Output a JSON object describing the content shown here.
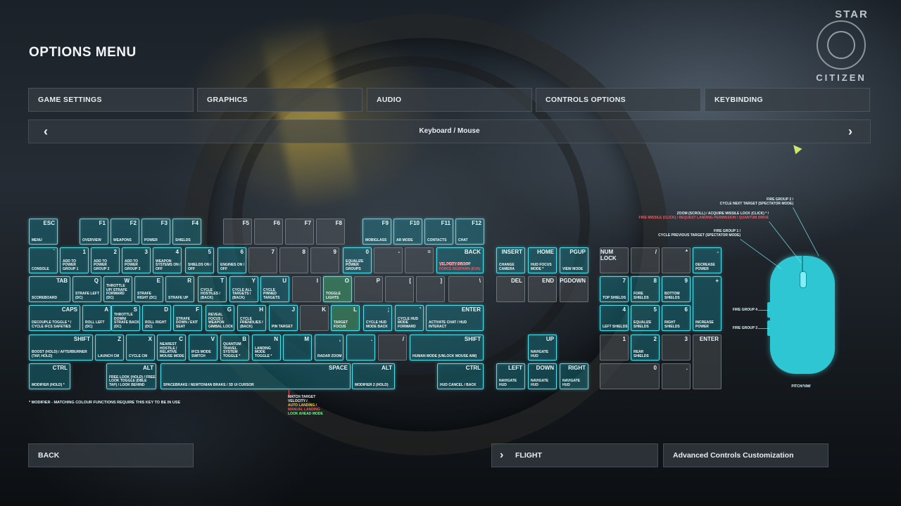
{
  "window": {
    "title": "OPTIONS MENU"
  },
  "logo": {
    "line1": "STAR",
    "line2": "CITIZEN"
  },
  "tabs": [
    {
      "label": "GAME SETTINGS"
    },
    {
      "label": "GRAPHICS"
    },
    {
      "label": "AUDIO"
    },
    {
      "label": "CONTROLS OPTIONS"
    },
    {
      "label": "KEYBINDING"
    }
  ],
  "subnav": {
    "label": "Keyboard / Mouse",
    "prev_icon": "‹",
    "next_icon": "›"
  },
  "legend_note": "* MODIFIER - MATCHING COLOUR FUNCTIONS REQUIRE THIS KEY TO BE IN USE",
  "m_key_note": {
    "line1": "MATCH TARGET",
    "line2": "VELOCITY /",
    "line3": "AUTO LANDING /",
    "line4": "MANUAL LANDING",
    "line5": "LOOK AHEAD MODE"
  },
  "mouse": {
    "fg2": "FIRE GROUP 2 /",
    "cycle_next": "CYCLE NEXT TARGET (SPECTATOR MODE)",
    "zoom": "ZOOM (SCROLL) / ACQUIRE MISSILE LOCK (CLICK) * /",
    "fire_missile": "FIRE MISSILE (CLICK) / REQUEST LANDING PERMISSION / QUANTUM DRIVE",
    "fg1": "FIRE GROUP 1 /",
    "cycle_prev": "CYCLE PREVIOUS TARGET (SPECTATOR MODE)",
    "fg4": "FIRE GROUP 4",
    "fg3": "FIRE GROUP 3",
    "pitch": "PITCH/YAW"
  },
  "buttons": {
    "back": "BACK",
    "flight": "FLIGHT",
    "advanced": "Advanced Controls Customization"
  },
  "keys": [
    {
      "l": "ESC",
      "f": "MENU"
    },
    {
      "l": "F1",
      "f": "OVERVIEW"
    },
    {
      "l": "F2",
      "f": "WEAPONS"
    },
    {
      "l": "F3",
      "f": "POWER"
    },
    {
      "l": "F4",
      "f": "SHIELDS"
    },
    {
      "l": "F5",
      "f": ""
    },
    {
      "l": "F6",
      "f": ""
    },
    {
      "l": "F7",
      "f": ""
    },
    {
      "l": "F8",
      "f": ""
    },
    {
      "l": "F9",
      "f": "MOBIGLASS"
    },
    {
      "l": "F10",
      "f": "AR MODE"
    },
    {
      "l": "F11",
      "f": "CONTACTS"
    },
    {
      "l": "F12",
      "f": "CHAT"
    },
    {
      "l": "`",
      "f": "CONSOLE"
    },
    {
      "l": "1",
      "f": "ADD TO POWER GROUP 1"
    },
    {
      "l": "2",
      "f": "ADD TO POWER GROUP 2"
    },
    {
      "l": "3",
      "f": "ADD TO POWER GROUP 3"
    },
    {
      "l": "4",
      "f": "WEAPON SYSTEMS ON / OFF"
    },
    {
      "l": "5",
      "f": "SHIELDS ON / OFF"
    },
    {
      "l": "6",
      "f": "ENGINES ON / OFF"
    },
    {
      "l": "7",
      "f": ""
    },
    {
      "l": "8",
      "f": ""
    },
    {
      "l": "9",
      "f": ""
    },
    {
      "l": "0",
      "f": "EQUALIZE POWER GROUPS"
    },
    {
      "l": "-",
      "f": ""
    },
    {
      "l": "=",
      "f": ""
    },
    {
      "l": "BACK",
      "f": "VELOCITY DROOP"
    },
    {
      "l": "TAB",
      "f": "SCOREBOARD"
    },
    {
      "l": "Q",
      "f": "STRAFE LEFT (DC)"
    },
    {
      "l": "W",
      "f": "THROTTLE UP/ STRAFE FORWARD (DC)"
    },
    {
      "l": "E",
      "f": "STRAFE RIGHT (DC)"
    },
    {
      "l": "R",
      "f": "STRAFE UP"
    },
    {
      "l": "T",
      "f": "CYCLE HOSTILES / (BACK)"
    },
    {
      "l": "Y",
      "f": "CYCLE ALL TARGETS / (BACK)"
    },
    {
      "l": "U",
      "f": "CYCLE PINNED TARGETS"
    },
    {
      "l": "I",
      "f": ""
    },
    {
      "l": "O",
      "f": "TOGGLE LIGHTS"
    },
    {
      "l": "P",
      "f": ""
    },
    {
      "l": "[",
      "f": ""
    },
    {
      "l": "]",
      "f": ""
    },
    {
      "l": "\\",
      "f": ""
    },
    {
      "l": "CAPS",
      "f": "DECOUPLE TOGGLE * / CYCLE IFCS SAFETIES"
    },
    {
      "l": "A",
      "f": "ROLL LEFT (DC)"
    },
    {
      "l": "S",
      "f": "THROTTLE DOWN/ STRAFE BACK (DC)"
    },
    {
      "l": "D",
      "f": "ROLL RIGHT (DC)"
    },
    {
      "l": "F",
      "f": "STRAFE DOWN / EXIT SEAT"
    },
    {
      "l": "G",
      "f": "REVEAL FOCUS / WEAPON GIMBAL LOCK"
    },
    {
      "l": "H",
      "f": "CYCLE FRIENDLIES / (BACK)"
    },
    {
      "l": "J",
      "f": "PIN TARGET"
    },
    {
      "l": "K",
      "f": ""
    },
    {
      "l": "L",
      "f": "TARGET FOCUS"
    },
    {
      "l": ";",
      "f": "CYCLE HUD MODE BACK"
    },
    {
      "l": "'",
      "f": "CYCLE HUD MODE FORWARD"
    },
    {
      "l": "ENTER",
      "f": "ACTIVATE CHAT / HUD INTERACT"
    },
    {
      "l": "SHIFT",
      "f": "BOOST (HOLD) / AFTERBURNER (TAP, HOLD)"
    },
    {
      "l": "Z",
      "f": "LAUNCH CM"
    },
    {
      "l": "X",
      "f": "CYCLE CM"
    },
    {
      "l": "C",
      "f": "NEAREST HOSTILE / RELATIVE MOUSE MODE"
    },
    {
      "l": "V",
      "f": "IFCS MODE SWITCH"
    },
    {
      "l": "B",
      "f": "QUANTUM TRAVEL SYSTEM TOGGLE *"
    },
    {
      "l": "N",
      "f": "LANDING MODE TOGGLE *"
    },
    {
      "l": "M",
      "f": ""
    },
    {
      "l": ",",
      "f": "RADAR ZOOM"
    },
    {
      "l": ".",
      "f": ""
    },
    {
      "l": "/",
      "f": ""
    },
    {
      "l": "SHIFT",
      "f": "HUMAN MODE (UNLOCK MOUSE AIM)"
    },
    {
      "l": "CTRL",
      "f": "MODIFIER (HOLD) *"
    },
    {
      "l": "ALT",
      "f": "FREE LOOK (HOLD) / FREE LOOK TOGGLE (DBLE TAP) / LOOK BEHIND"
    },
    {
      "l": "SPACE",
      "f": "SPACEBRAKE / NEWTONIAN BRAKE / 3D UI CURSOR"
    },
    {
      "l": "ALT",
      "f": "MODIFIER 2 (HOLD)"
    },
    {
      "l": "CTRL",
      "f": "HUD CANCEL / BACK"
    },
    {
      "l": "INSERT",
      "f": "CHANGE CAMERA"
    },
    {
      "l": "HOME",
      "f": "HUD FOCUS MODE *"
    },
    {
      "l": "PGUP",
      "f": "VIEW MODE"
    },
    {
      "l": "DEL",
      "f": ""
    },
    {
      "l": "END",
      "f": ""
    },
    {
      "l": "PGDOWN",
      "f": ""
    },
    {
      "l": "UP",
      "f": "NAVIGATE HUD"
    },
    {
      "l": "LEFT",
      "f": "NAVIGATE HUD"
    },
    {
      "l": "DOWN",
      "f": "NAVIGATE HUD"
    },
    {
      "l": "RIGHT",
      "f": "NAVIGATE HUD"
    },
    {
      "l": "NUM LOCK",
      "f": ""
    },
    {
      "l": "/",
      "f": ""
    },
    {
      "l": "*",
      "f": ""
    },
    {
      "l": "-",
      "f": "DECREASE POWER"
    },
    {
      "l": "7",
      "f": "TOP SHIELDS"
    },
    {
      "l": "8",
      "f": "FORE SHIELDS"
    },
    {
      "l": "9",
      "f": "BOTTOM SHIELDS"
    },
    {
      "l": "+",
      "f": "INCREASE POWER"
    },
    {
      "l": "4",
      "f": "LEFT SHIELDS"
    },
    {
      "l": "5",
      "f": "EQUALIZE SHIELDS"
    },
    {
      "l": "6",
      "f": "RIGHT SHIELDS"
    },
    {
      "l": "1",
      "f": ""
    },
    {
      "l": "2",
      "f": "REAR SHIELDS"
    },
    {
      "l": "3",
      "f": ""
    },
    {
      "l": "ENTER",
      "f": ""
    },
    {
      "l": "0",
      "f": ""
    },
    {
      "l": ".",
      "f": ""
    }
  ],
  "back_extra": "SELF DESTRUCT / FORCE RESPAWN (EVA)"
}
